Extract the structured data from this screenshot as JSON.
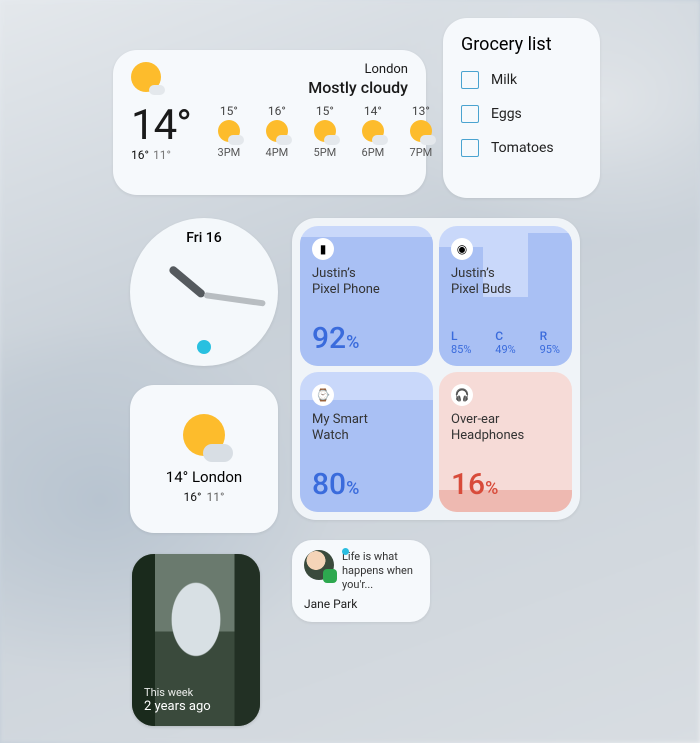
{
  "weather": {
    "location": "London",
    "condition": "Mostly cloudy",
    "temp": "14°",
    "high": "16°",
    "low": "11°",
    "forecast": [
      {
        "temp": "15°",
        "hour": "3PM"
      },
      {
        "temp": "16°",
        "hour": "4PM"
      },
      {
        "temp": "15°",
        "hour": "5PM"
      },
      {
        "temp": "14°",
        "hour": "6PM"
      },
      {
        "temp": "13°",
        "hour": "7PM"
      }
    ]
  },
  "grocery": {
    "title": "Grocery list",
    "items": [
      "Milk",
      "Eggs",
      "Tomatoes"
    ]
  },
  "clock": {
    "label": "Fri 16"
  },
  "devices": {
    "phone": {
      "name": "Justin’s\nPixel Phone",
      "pct": "92",
      "unit": "%"
    },
    "buds": {
      "name": "Justin’s\nPixel Buds",
      "l_label": "L",
      "l": "85%",
      "c_label": "C",
      "c": "49%",
      "r_label": "R",
      "r": "95%"
    },
    "watch": {
      "name": "My Smart\nWatch",
      "pct": "80",
      "unit": "%"
    },
    "head": {
      "name": "Over-ear\nHeadphones",
      "pct": "16",
      "unit": "%"
    }
  },
  "weather_small": {
    "temp_city": "14° London",
    "high": "16°",
    "low": "11°"
  },
  "memory": {
    "caption_a": "This week",
    "caption_b": "2 years ago"
  },
  "notification": {
    "message": "Life is what happens when you'r...",
    "sender": "Jane Park"
  }
}
